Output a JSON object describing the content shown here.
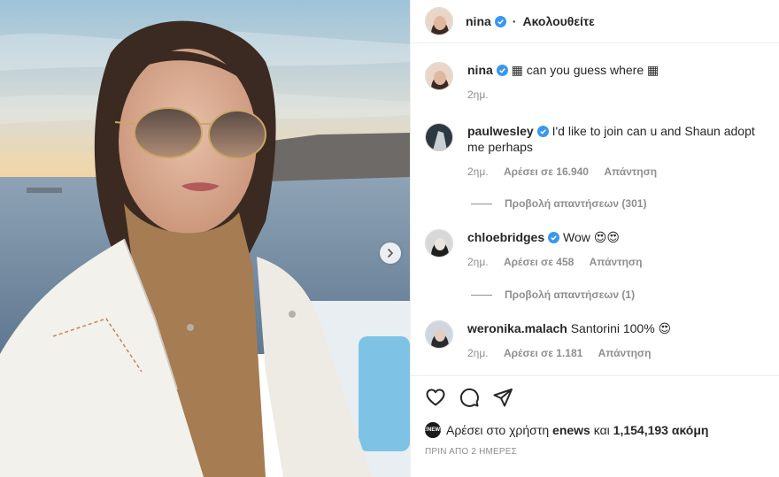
{
  "header": {
    "username": "nina",
    "separator": "·",
    "follow_label": "Ακολουθείτε"
  },
  "photo": {
    "alt": "selfie"
  },
  "caption": {
    "username": "nina",
    "text": "can you guess where",
    "emoji_before": "▦",
    "emoji_after": "▦",
    "time": "2ημ."
  },
  "comments": [
    {
      "username": "paulwesley",
      "text": "I'd like to join can u and Shaun adopt me perhaps",
      "time": "2ημ.",
      "likes": "Αρέσει σε 16.940",
      "reply": "Απάντηση",
      "view_replies": "Προβολή απαντήσεων (301)"
    },
    {
      "username": "chloebridges",
      "text": "Wow 😍😍",
      "time": "2ημ.",
      "likes": "Αρέσει σε 458",
      "reply": "Απάντηση",
      "view_replies": "Προβολή απαντήσεων (1)"
    },
    {
      "username": "weronika.malach",
      "text": "Santorini 100% 😍",
      "time": "2ημ.",
      "likes": "Αρέσει σε 1.181",
      "reply": "Απάντηση"
    }
  ],
  "likes_line": {
    "prefix": "Αρέσει στο χρήστη",
    "user": "enews",
    "conj": "και",
    "count": "1,154,193 ακόμη",
    "mini_avatar": "E!NEWS"
  },
  "timestamp": "ΠΡΙΝ ΑΠΟ 2 ΗΜΕΡΕΣ",
  "colors": {
    "verified": "#3897f0",
    "muted": "#8e8e8e",
    "text": "#262626"
  }
}
